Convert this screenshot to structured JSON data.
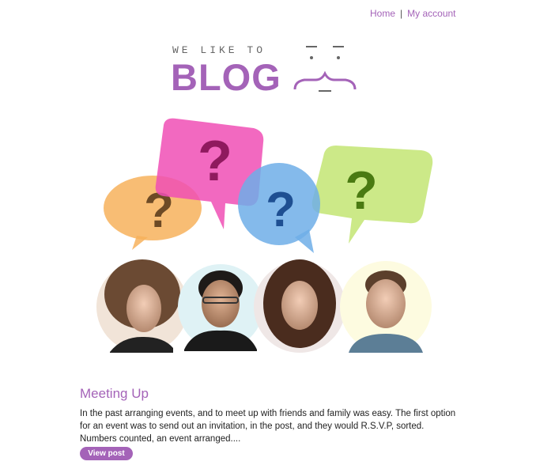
{
  "nav": {
    "home": "Home",
    "separator": "|",
    "account": "My account"
  },
  "logo": {
    "tagline": "WE LIKE TO",
    "word": "BLOG"
  },
  "hero": {
    "bubbles": [
      {
        "name": "orange-bubble",
        "color": "#f7b25c",
        "mark": "?"
      },
      {
        "name": "pink-bubble",
        "color": "#f04fb5",
        "mark": "?"
      },
      {
        "name": "blue-bubble",
        "color": "#6eaee8",
        "mark": "?"
      },
      {
        "name": "green-bubble",
        "color": "#bfe36a",
        "mark": "?"
      }
    ]
  },
  "post": {
    "title": "Meeting Up",
    "excerpt": "In the past arranging events, and to meet up with friends and family was easy. The first option for an event was to send out an invitation, in the post, and they would R.S.V.P, sorted. Numbers counted, an event arranged....",
    "button": "View post"
  },
  "colors": {
    "accent": "#a463b8"
  }
}
